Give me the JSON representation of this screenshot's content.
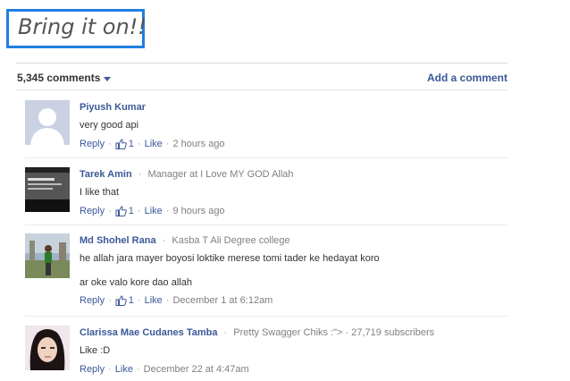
{
  "title": "Bring it on!!",
  "header": {
    "count_label": "5,345 comments",
    "add_comment_label": "Add a comment"
  },
  "actions": {
    "reply": "Reply",
    "like": "Like"
  },
  "comments": [
    {
      "author": "Piyush Kumar",
      "meta": "",
      "text": "very good api",
      "text2": "",
      "likes": "1",
      "time": "2 hours ago"
    },
    {
      "author": "Tarek Amin",
      "meta": "Manager at I Love MY GOD Allah",
      "text": "I like that",
      "text2": "",
      "likes": "1",
      "time": "9 hours ago"
    },
    {
      "author": "Md Shohel Rana",
      "meta": "Kasba T Ali Degree college",
      "text": "he allah jara mayer boyosi loktike merese tomi tader ke hedayat koro",
      "text2": "ar oke valo kore dao allah",
      "likes": "1",
      "time": "December 1 at 6:12am"
    },
    {
      "author": "Clarissa Mae Cudanes Tamba",
      "meta": "Pretty Swagger Chiks :\"> · 27,719 subscribers",
      "text": "Like :D",
      "text2": "",
      "likes": "",
      "time": "December 22 at 4:47am"
    }
  ]
}
